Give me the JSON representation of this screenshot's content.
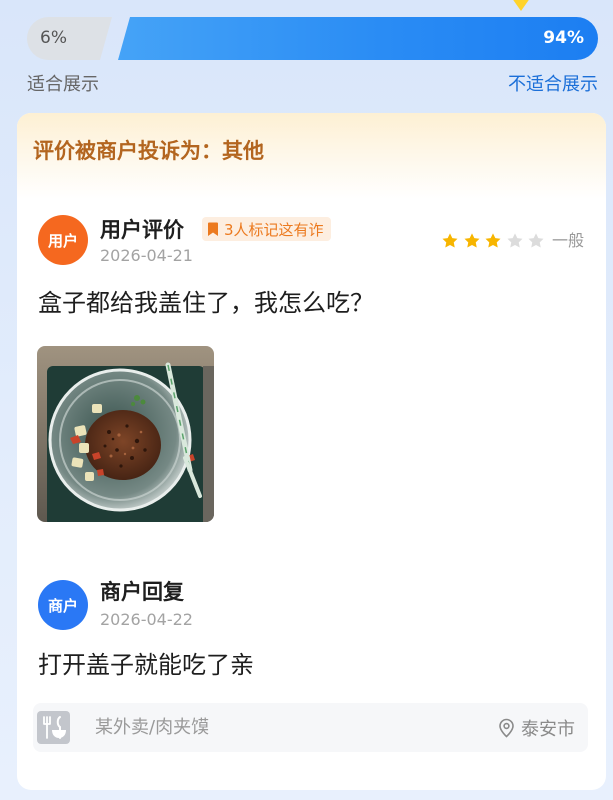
{
  "vote_bar": {
    "left_percent": "6%",
    "right_percent": "94%",
    "left_label": "适合展示",
    "right_label": "不适合展示"
  },
  "complaint": {
    "title": "评价被商户投诉为：其他"
  },
  "review": {
    "avatar_text": "用户",
    "title": "用户评价",
    "badge_text": "3人标记这有诈",
    "date": "2026-04-21",
    "rating": 3,
    "rating_max": 5,
    "rating_label": "一般",
    "content": "盒子都给我盖住了，我怎么吃？"
  },
  "reply": {
    "avatar_text": "商户",
    "title": "商户回复",
    "date": "2026-04-22",
    "content": "打开盖子就能吃了亲"
  },
  "footer": {
    "shop_text": "某外卖/肉夹馍",
    "location": "泰安市"
  },
  "icons": {
    "vote_marker": "triangle-marker-icon",
    "badge": "bookmark-icon",
    "rating": "star-icon",
    "review_photo": "food-photo",
    "shop": "shop-thumbnail-icon",
    "location": "location-pin-icon"
  },
  "colors": {
    "brand_blue": "#1f80f2",
    "complaint_text": "#b3651f",
    "badge_orange": "#ec7a1f",
    "badge_background": "#fdeee0",
    "user_avatar": "#f5681f",
    "merchant_avatar": "#2a78f5",
    "star_filled": "#f7b500",
    "star_empty": "#dcdcdc"
  }
}
